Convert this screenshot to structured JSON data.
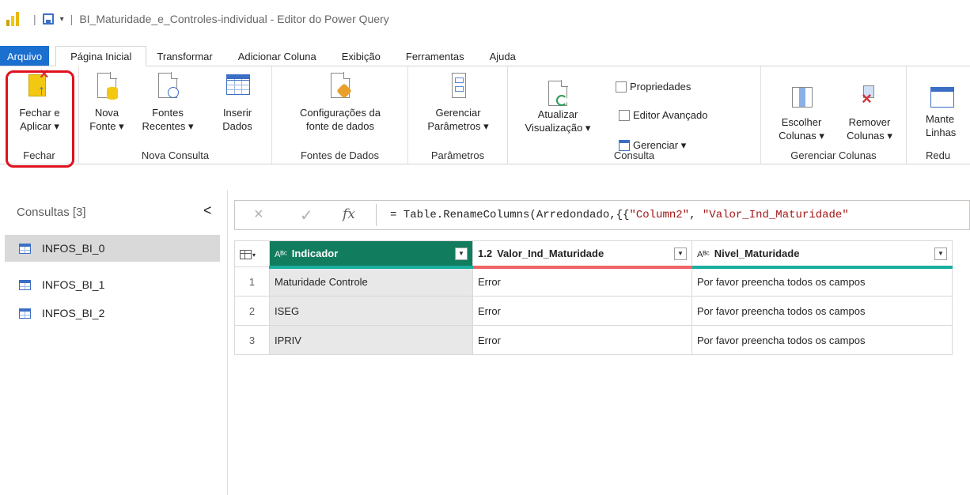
{
  "window": {
    "title": "BI_Maturidade_e_Controles-individual - Editor do Power Query",
    "separator": "|"
  },
  "menu": {
    "tabs": [
      "Arquivo",
      "Página Inicial",
      "Transformar",
      "Adicionar Coluna",
      "Exibição",
      "Ferramentas",
      "Ajuda"
    ],
    "active": "Página Inicial"
  },
  "ribbon": {
    "fechar": {
      "line1": "Fechar e",
      "line2": "Aplicar ▾",
      "group": "Fechar"
    },
    "nova_consulta": {
      "nova_fonte": {
        "line1": "Nova",
        "line2": "Fonte ▾"
      },
      "fontes_recentes": {
        "line1": "Fontes",
        "line2": "Recentes ▾"
      },
      "inserir_dados": {
        "line1": "Inserir",
        "line2": "Dados"
      },
      "group": "Nova Consulta"
    },
    "fontes_de_dados": {
      "config": {
        "line1": "Configurações da",
        "line2": "fonte de dados"
      },
      "group": "Fontes de Dados"
    },
    "parametros": {
      "gerenciar": {
        "line1": "Gerenciar",
        "line2": "Parâmetros ▾"
      },
      "group": "Parâmetros"
    },
    "consulta": {
      "atualizar": {
        "line1": "Atualizar",
        "line2": "Visualização ▾"
      },
      "propriedades": "Propriedades",
      "editor_avancado": "Editor Avançado",
      "gerenciar": "Gerenciar ▾",
      "group": "Consulta"
    },
    "gerenciar_colunas": {
      "escolher": {
        "line1": "Escolher",
        "line2": "Colunas ▾"
      },
      "remover": {
        "line1": "Remover",
        "line2": "Colunas ▾"
      },
      "group": "Gerenciar Colunas"
    },
    "reduzir": {
      "manter": {
        "line1": "Mante",
        "line2": "Linhas"
      },
      "group": "Redu"
    }
  },
  "queries": {
    "header": "Consultas [3]",
    "collapse": "<",
    "items": [
      "INFOS_BI_0",
      "INFOS_BI_1",
      "INFOS_BI_2"
    ],
    "selected": "INFOS_BI_0"
  },
  "formula": {
    "cancel": "×",
    "confirm": "✓",
    "fx": "fx",
    "prefix": "= Table.RenameColumns(Arredondado,{{",
    "str1": "\"Column2\"",
    "mid": ", ",
    "str2": "\"Valor_Ind_Maturidade\""
  },
  "table": {
    "columns": [
      {
        "type": "Aᴮᶜ",
        "name": "Indicador"
      },
      {
        "type": "1.2",
        "name": "Valor_Ind_Maturidade"
      },
      {
        "type": "Aᴮᶜ",
        "name": "Nivel_Maturidade"
      }
    ],
    "rows": [
      {
        "n": "1",
        "indicador": "Maturidade Controle",
        "valor": "Error",
        "nivel": "Por favor preencha todos os campos"
      },
      {
        "n": "2",
        "indicador": "ISEG",
        "valor": "Error",
        "nivel": "Por favor preencha todos os campos"
      },
      {
        "n": "3",
        "indicador": "IPRIV",
        "valor": "Error",
        "nivel": "Por favor preencha todos os campos"
      }
    ]
  },
  "colors": {
    "file_tab": "#1a6fcf",
    "selected_header": "#127c5e",
    "error_bar": "#f06566",
    "quality_bar": "#1aae9f",
    "highlight": "#e0121d"
  }
}
